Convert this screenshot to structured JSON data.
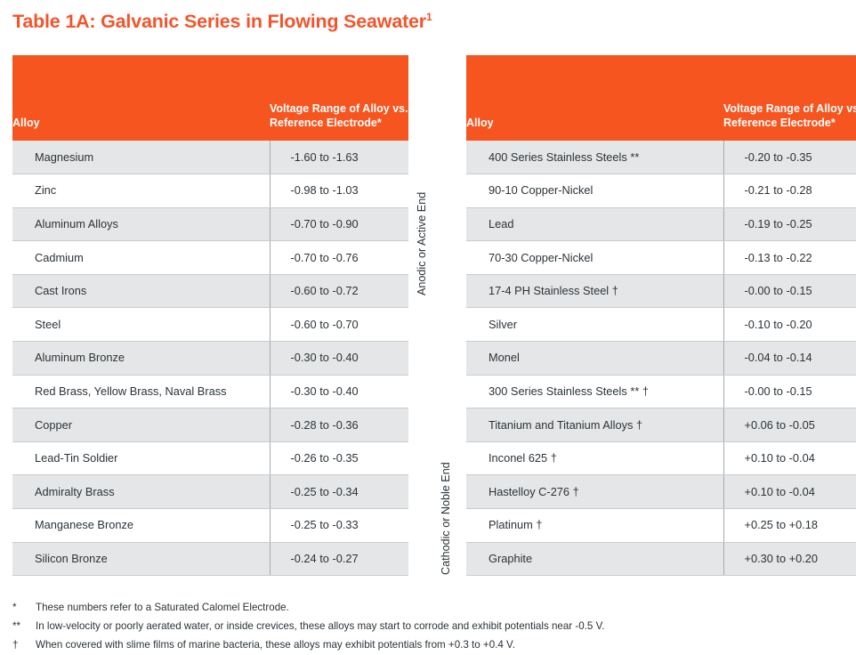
{
  "title": {
    "text": "Table 1A: Galvanic Series in Flowing Seawater",
    "superscript": "1"
  },
  "columns": {
    "alloy": "Alloy",
    "voltage": "Voltage Range of Alloy vs. Reference Electrode*"
  },
  "axis_labels": {
    "anodic": "Anodic or Active End",
    "cathodic": "Cathodic or Noble End"
  },
  "tables": [
    {
      "id": "left",
      "rows": [
        {
          "alloy": "Magnesium",
          "voltage": "-1.60 to -1.63"
        },
        {
          "alloy": "Zinc",
          "voltage": "-0.98 to -1.03"
        },
        {
          "alloy": "Aluminum Alloys",
          "voltage": "-0.70 to -0.90"
        },
        {
          "alloy": "Cadmium",
          "voltage": "-0.70 to -0.76"
        },
        {
          "alloy": "Cast Irons",
          "voltage": "-0.60 to -0.72"
        },
        {
          "alloy": "Steel",
          "voltage": "-0.60 to -0.70"
        },
        {
          "alloy": "Aluminum Bronze",
          "voltage": "-0.30 to -0.40"
        },
        {
          "alloy": "Red Brass, Yellow Brass, Naval Brass",
          "voltage": "-0.30 to -0.40"
        },
        {
          "alloy": "Copper",
          "voltage": "-0.28 to -0.36"
        },
        {
          "alloy": "Lead-Tin Soldier",
          "voltage": "-0.26 to -0.35"
        },
        {
          "alloy": "Admiralty Brass",
          "voltage": "-0.25 to -0.34"
        },
        {
          "alloy": "Manganese Bronze",
          "voltage": "-0.25 to -0.33"
        },
        {
          "alloy": "Silicon Bronze",
          "voltage": "-0.24 to -0.27"
        }
      ]
    },
    {
      "id": "right",
      "rows": [
        {
          "alloy": "400 Series Stainless Steels **",
          "voltage": "-0.20 to -0.35"
        },
        {
          "alloy": "90-10 Copper-Nickel",
          "voltage": "-0.21 to -0.28"
        },
        {
          "alloy": "Lead",
          "voltage": "-0.19 to -0.25"
        },
        {
          "alloy": "70-30 Copper-Nickel",
          "voltage": "-0.13 to -0.22"
        },
        {
          "alloy": "17-4 PH Stainless Steel †",
          "voltage": "-0.00 to -0.15"
        },
        {
          "alloy": "Silver",
          "voltage": "-0.10 to -0.20"
        },
        {
          "alloy": "Monel",
          "voltage": "-0.04 to -0.14"
        },
        {
          "alloy": "300 Series Stainless Steels ** †",
          "voltage": "-0.00 to -0.15"
        },
        {
          "alloy": "Titanium and Titanium Alloys †",
          "voltage": "+0.06 to -0.05"
        },
        {
          "alloy": "Inconel 625 †",
          "voltage": "+0.10 to -0.04"
        },
        {
          "alloy": "Hastelloy C-276 †",
          "voltage": "+0.10 to -0.04"
        },
        {
          "alloy": "Platinum †",
          "voltage": "+0.25 to +0.18"
        },
        {
          "alloy": "Graphite",
          "voltage": "+0.30 to +0.20"
        }
      ]
    }
  ],
  "footnotes": [
    {
      "mark": "*",
      "text": "These numbers refer to a Saturated Calomel Electrode."
    },
    {
      "mark": "**",
      "text": "In low-velocity or poorly aerated water, or inside crevices, these alloys may start to corrode and exhibit potentials near -0.5 V."
    },
    {
      "mark": "†",
      "text": "When covered with slime films of marine bacteria, these alloys may exhibit potentials from +0.3 to +0.4 V."
    }
  ],
  "colors": {
    "accent": "#f7551f",
    "title": "#f2552c",
    "stripe": "#e5e6e7",
    "text": "#2c3338",
    "border": "#c9cbcd"
  }
}
